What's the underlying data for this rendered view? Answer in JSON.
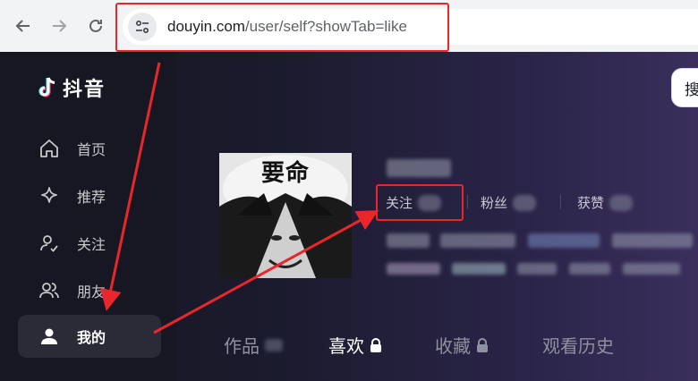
{
  "browser": {
    "url_domain": "douyin.com",
    "url_path": "/user/self?showTab=like",
    "back_icon": "back-arrow-icon",
    "forward_icon": "forward-arrow-icon",
    "reload_icon": "reload-icon",
    "site_info_icon": "site-info-icon"
  },
  "app": {
    "logo_text": "抖音",
    "search_label": "搜",
    "sidebar": [
      {
        "label": "首页",
        "icon": "home-icon"
      },
      {
        "label": "推荐",
        "icon": "sparkle-icon"
      },
      {
        "label": "关注",
        "icon": "follow-icon"
      },
      {
        "label": "朋友",
        "icon": "friends-icon"
      },
      {
        "label": "我的",
        "icon": "user-icon",
        "active": true
      }
    ],
    "profile": {
      "avatar_caption": "要命",
      "stats": [
        {
          "label": "关注"
        },
        {
          "label": "粉丝"
        },
        {
          "label": "获赞"
        }
      ]
    },
    "tabs": [
      {
        "label": "作品",
        "locked": false
      },
      {
        "label": "喜欢",
        "locked": true,
        "active": true
      },
      {
        "label": "收藏",
        "locked": true
      },
      {
        "label": "观看历史",
        "locked": false
      }
    ]
  },
  "colors": {
    "annotation": "#e8262b",
    "background": "#161823",
    "active_tab": "#ffffff"
  }
}
